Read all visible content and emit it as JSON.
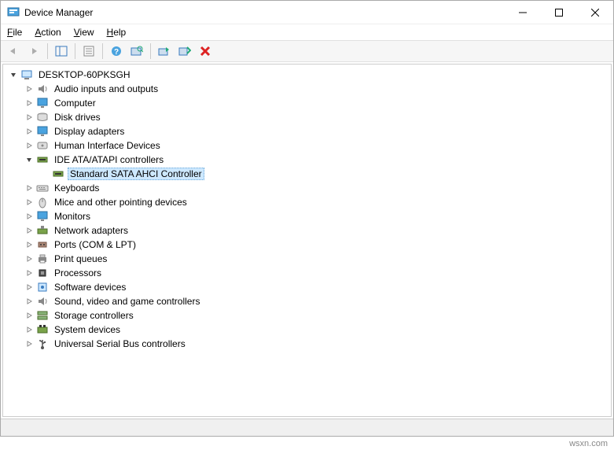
{
  "title": "Device Manager",
  "menu": {
    "file": "File",
    "action": "Action",
    "view": "View",
    "help": "Help"
  },
  "toolbar": {
    "back": "Back",
    "forward": "Forward",
    "show_hide": "Show/Hide Console Tree",
    "properties": "Properties",
    "help": "Help",
    "scan": "Scan for hardware changes",
    "update": "Update device driver",
    "enable": "Enable device",
    "uninstall": "Uninstall device"
  },
  "tree": {
    "root": "DESKTOP-60PKSGH",
    "nodes": [
      {
        "label": "Audio inputs and outputs",
        "icon": "speaker"
      },
      {
        "label": "Computer",
        "icon": "monitor"
      },
      {
        "label": "Disk drives",
        "icon": "disk"
      },
      {
        "label": "Display adapters",
        "icon": "monitor"
      },
      {
        "label": "Human Interface Devices",
        "icon": "hid"
      },
      {
        "label": "IDE ATA/ATAPI controllers",
        "icon": "ide",
        "expanded": true,
        "children": [
          {
            "label": "Standard SATA AHCI Controller",
            "icon": "ide",
            "selected": true
          }
        ]
      },
      {
        "label": "Keyboards",
        "icon": "keyboard"
      },
      {
        "label": "Mice and other pointing devices",
        "icon": "mouse"
      },
      {
        "label": "Monitors",
        "icon": "monitor"
      },
      {
        "label": "Network adapters",
        "icon": "network"
      },
      {
        "label": "Ports (COM & LPT)",
        "icon": "port"
      },
      {
        "label": "Print queues",
        "icon": "printer"
      },
      {
        "label": "Processors",
        "icon": "cpu"
      },
      {
        "label": "Software devices",
        "icon": "software"
      },
      {
        "label": "Sound, video and game controllers",
        "icon": "speaker"
      },
      {
        "label": "Storage controllers",
        "icon": "storage"
      },
      {
        "label": "System devices",
        "icon": "system"
      },
      {
        "label": "Universal Serial Bus controllers",
        "icon": "usb"
      }
    ]
  },
  "footer": "wsxn.com"
}
